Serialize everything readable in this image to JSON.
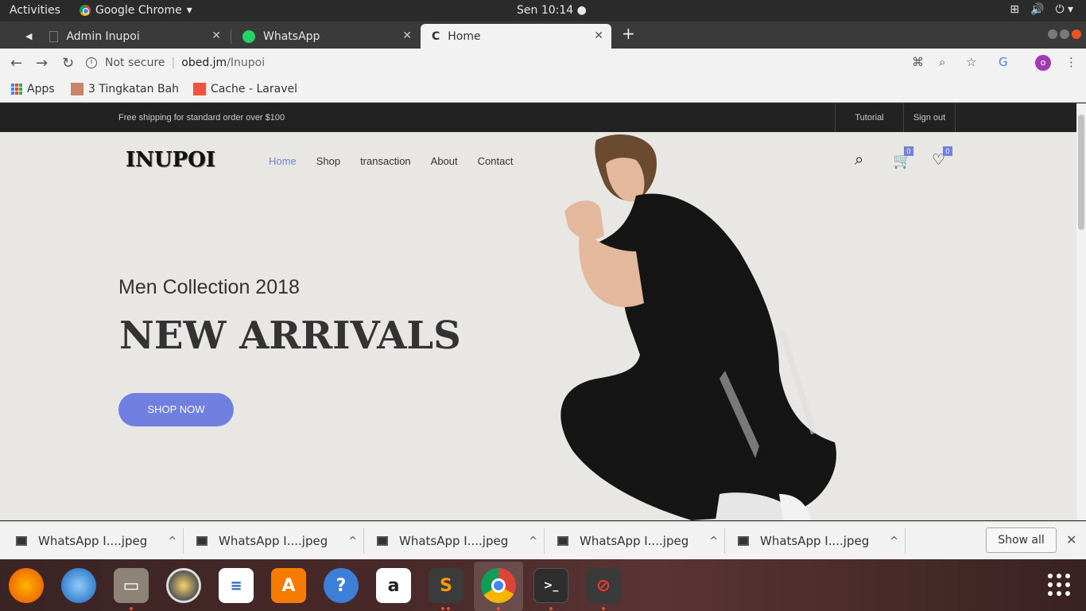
{
  "system": {
    "activities": "Activities",
    "app_name": "Google Chrome",
    "clock": "Sen 10:14"
  },
  "tabs": [
    {
      "label": "Admin Inupoi"
    },
    {
      "label": "WhatsApp"
    },
    {
      "label": "Home",
      "active": true
    }
  ],
  "omnibox": {
    "security": "Not secure",
    "host": "obed.jm",
    "path": "/Inupoi"
  },
  "bookmarks": [
    {
      "label": "Apps"
    },
    {
      "label": "3 Tingkatan Bah"
    },
    {
      "label": "Cache - Laravel -"
    }
  ],
  "site": {
    "promo": "Free shipping for standard order over $100",
    "top_links": [
      "Tutorial",
      "Sign out"
    ],
    "logo": "INUPOI",
    "menu": [
      "Home",
      "Shop",
      "transaction",
      "About",
      "Contact"
    ],
    "cart_count": "0",
    "wishlist_count": "0",
    "hero_subtitle": "Men Collection 2018",
    "hero_title": "NEW ARRIVALS",
    "cta": "SHOP NOW"
  },
  "downloads": {
    "items": [
      "WhatsApp I....jpeg",
      "WhatsApp I....jpeg",
      "WhatsApp I....jpeg",
      "WhatsApp I....jpeg",
      "WhatsApp I....jpeg"
    ],
    "show_all": "Show all"
  },
  "colors": {
    "accent": "#717fe0",
    "ubuntu_orange": "#e95420"
  }
}
